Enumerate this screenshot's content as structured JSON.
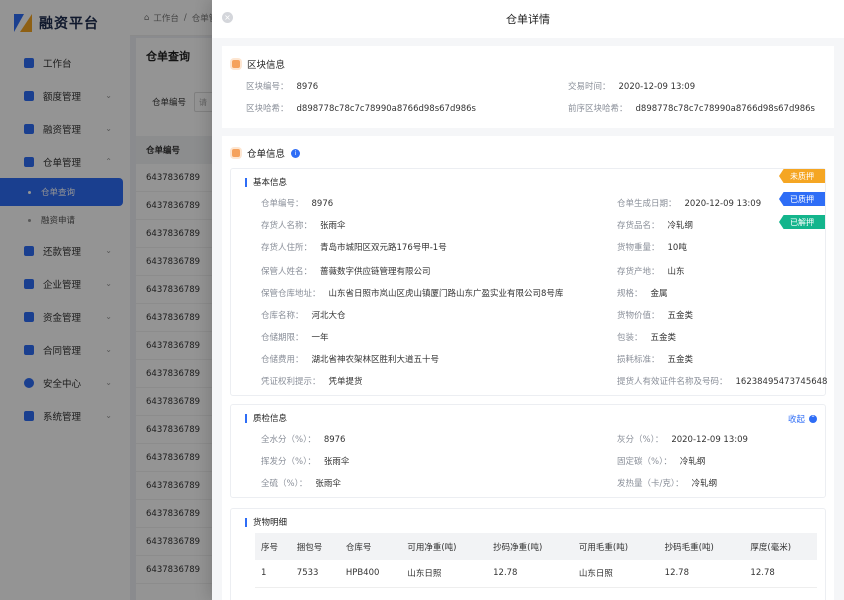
{
  "app": {
    "name": "融资平台"
  },
  "sidebar": {
    "items": [
      {
        "label": "工作台",
        "icon": "dashboard-icon"
      },
      {
        "label": "额度管理",
        "icon": "quota-icon"
      },
      {
        "label": "融资管理",
        "icon": "finance-icon"
      },
      {
        "label": "仓单管理",
        "icon": "receipt-icon",
        "expanded": true,
        "children": [
          {
            "label": "仓单查询",
            "active": true
          },
          {
            "label": "融资申请",
            "active": false
          }
        ]
      },
      {
        "label": "还款管理",
        "icon": "repay-icon"
      },
      {
        "label": "企业管理",
        "icon": "company-icon"
      },
      {
        "label": "资金管理",
        "icon": "fund-icon"
      },
      {
        "label": "合同管理",
        "icon": "contract-icon"
      },
      {
        "label": "安全中心",
        "icon": "shield-icon"
      },
      {
        "label": "系统管理",
        "icon": "settings-icon"
      }
    ]
  },
  "breadcrumb": {
    "home": "工作台",
    "current": "仓单管"
  },
  "page": {
    "title": "仓单查询",
    "filter_label": "仓单编号",
    "filter_placeholder": "请",
    "column_header": "仓单编号",
    "rows": [
      "6437836789",
      "6437836789",
      "6437836789",
      "6437836789",
      "6437836789",
      "6437836789",
      "6437836789",
      "6437836789",
      "6437836789",
      "6437836789",
      "6437836789",
      "6437836789",
      "6437836789",
      "6437836789",
      "6437836789"
    ]
  },
  "drawer": {
    "title": "仓单详情",
    "close": "×",
    "block": {
      "title": "区块信息",
      "fields": [
        {
          "label": "区块编号：",
          "value": "8976"
        },
        {
          "label": "交易时间：",
          "value": "2020-12-09  13:09"
        },
        {
          "label": "区块哈希：",
          "value": "d898778c78c7c78990a8766d98s67d986s"
        },
        {
          "label": "前序区块哈希：",
          "value": "d898778c78c7c78990a8766d98s67d986s"
        }
      ]
    },
    "receipt": {
      "title": "仓单信息",
      "info_icon": "i",
      "tags": [
        {
          "label": "未质押",
          "color": "#f5a623"
        },
        {
          "label": "已质押",
          "color": "#2e6df6"
        },
        {
          "label": "已解押",
          "color": "#13b58c"
        }
      ],
      "basic": {
        "title": "基本信息",
        "left": [
          {
            "label": "仓单编号：",
            "value": "8976"
          },
          {
            "label": "存货人名称：",
            "value": "张雨伞"
          },
          {
            "label": "存货人住所：",
            "value": "青岛市城阳区双元路176号甲-1号"
          },
          {
            "label": "保管人姓名：",
            "value": "蔷薇数字供应链管理有限公司"
          },
          {
            "label": "保管仓库地址：",
            "value": "山东省日照市岚山区虎山镇厦门路山东广盈实业有限公司8号库"
          },
          {
            "label": "仓库名称：",
            "value": "河北大仓"
          },
          {
            "label": "仓储期限：",
            "value": "一年"
          },
          {
            "label": "仓储费用：",
            "value": "湖北省神农架林区胜利大道五十号"
          },
          {
            "label": "凭证权利提示：",
            "value": "凭单提货"
          }
        ],
        "right": [
          {
            "label": "仓单生成日期：",
            "value": "2020-12-09  13:09"
          },
          {
            "label": "存货品名：",
            "value": "冷轧纲"
          },
          {
            "label": "货物重量：",
            "value": "10吨"
          },
          {
            "label": "存货产地：",
            "value": "山东"
          },
          {
            "label": "规格：",
            "value": "金属"
          },
          {
            "label": "货物价值：",
            "value": "五金类"
          },
          {
            "label": "包装：",
            "value": "五金类"
          },
          {
            "label": "损耗标准：",
            "value": "五金类"
          },
          {
            "label": "提货人有效证件名称及号码：",
            "value": "16238495473745648"
          }
        ]
      },
      "quality": {
        "title": "质检信息",
        "collapse_label": "收起",
        "left": [
          {
            "label": "全水分（%）：",
            "value": "8976"
          },
          {
            "label": "挥发分（%）：",
            "value": "张雨伞"
          },
          {
            "label": "全硫（%）：",
            "value": "张雨伞"
          }
        ],
        "right": [
          {
            "label": "灰分（%）：",
            "value": "2020-12-09  13:09"
          },
          {
            "label": "固定碳（%）：",
            "value": "冷轧纲"
          },
          {
            "label": "发热量（卡/克）：",
            "value": "冷轧纲"
          }
        ]
      },
      "goods": {
        "title": "货物明细",
        "columns": [
          "序号",
          "捆包号",
          "仓库号",
          "可用净重(吨)",
          "抄码净重(吨)",
          "可用毛重(吨)",
          "抄码毛重(吨)",
          "厚度(毫米)"
        ],
        "rows": [
          [
            "1",
            "7533",
            "HPB400",
            "山东日照",
            "12.78",
            "山东日照",
            "12.78",
            "12.78"
          ]
        ]
      }
    }
  }
}
